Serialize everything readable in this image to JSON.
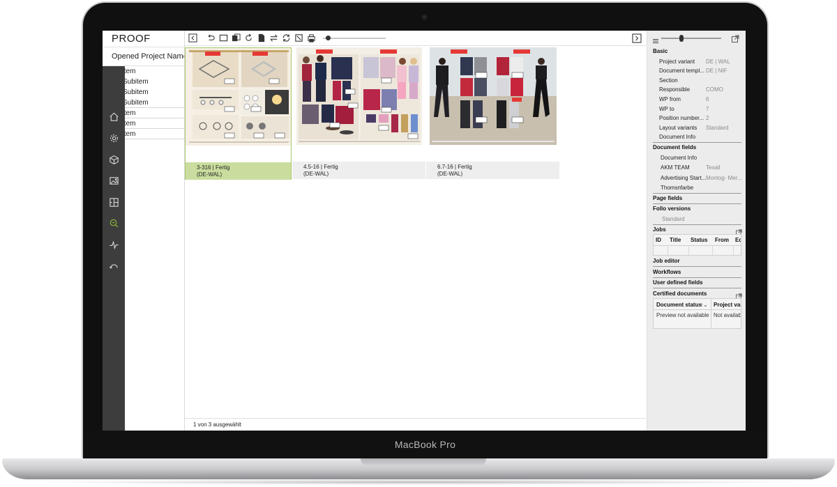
{
  "device": {
    "model_label": "MacBook Pro"
  },
  "app": {
    "title": "PROOF",
    "project_name": "Opened Project Name"
  },
  "tree": {
    "items": [
      {
        "label": "Item"
      },
      {
        "label": "Subitem"
      },
      {
        "label": "Subitem"
      },
      {
        "label": "Subitem"
      },
      {
        "label": "Item"
      },
      {
        "label": "Item"
      },
      {
        "label": "Item"
      }
    ]
  },
  "rail_icons": [
    "home-icon",
    "gear-icon",
    "cube-icon",
    "image-icon",
    "layout-icon",
    "zoom-icon",
    "activity-icon",
    "undo-curve-icon"
  ],
  "toolbar": {
    "icons": [
      "collapse-left-icon",
      "undo-icon",
      "frame-icon",
      "copy-icon",
      "rotate-icon",
      "document-icon",
      "swap-icon",
      "refresh-icon",
      "crop-icon",
      "print-icon"
    ],
    "zoom_level": 0.05
  },
  "thumbnails": [
    {
      "caption_line1": "3-316 | Fertig",
      "caption_line2": "(DE-WAL)",
      "selected": true
    },
    {
      "caption_line1": "4.5-16 | Fertig",
      "caption_line2": "(DE-WAL)",
      "selected": false
    },
    {
      "caption_line1": "6.7-16 | Fertig",
      "caption_line2": "(DE-WAL)",
      "selected": false
    }
  ],
  "status": {
    "selection_text": "1 von 3 ausgewählt"
  },
  "right_panel": {
    "basic": {
      "title": "Basic",
      "fields": [
        {
          "key": "Project variant",
          "value": "DE | WAL"
        },
        {
          "key": "Document templ...",
          "value": "DE | NIF"
        },
        {
          "key": "Section",
          "value": ""
        },
        {
          "key": "Responsible",
          "value": "COMO"
        },
        {
          "key": "WP from",
          "value": "6"
        },
        {
          "key": "WP to",
          "value": "7"
        },
        {
          "key": "Position number...",
          "value": "2"
        },
        {
          "key": "Layout variants",
          "value": "Standard"
        },
        {
          "key": "Document Info",
          "value": ""
        }
      ]
    },
    "document_fields": {
      "title": "Document fields",
      "fields": [
        {
          "key": "Document Info",
          "value": ""
        },
        {
          "key": "AKM TEAM",
          "value": "Texail"
        },
        {
          "key": "Advertising Start...",
          "value": "Montog- Mer..."
        },
        {
          "key": "Thomsnfarbe",
          "value": ""
        }
      ]
    },
    "page_fields": {
      "title": "Page fields"
    },
    "follo_versions": {
      "title": "Follo versions",
      "value": "Standard"
    },
    "jobs": {
      "title": "Jobs",
      "columns": [
        "ID",
        "Title",
        "Status",
        "From",
        "Ed"
      ]
    },
    "job_editor": {
      "title": "Job editor"
    },
    "workflows": {
      "title": "Workflows"
    },
    "user_defined": {
      "title": "User defined fields"
    },
    "certified": {
      "title": "Certified documents",
      "columns": [
        "Document status",
        "Project vari"
      ],
      "sort_indicator": "↑⌄",
      "row": [
        "Preview not available",
        "Not availab"
      ]
    }
  },
  "colors": {
    "rail": "#3d3d3d",
    "selected_caption": "#cadd9e",
    "accent_icon": "#8ab33a"
  }
}
